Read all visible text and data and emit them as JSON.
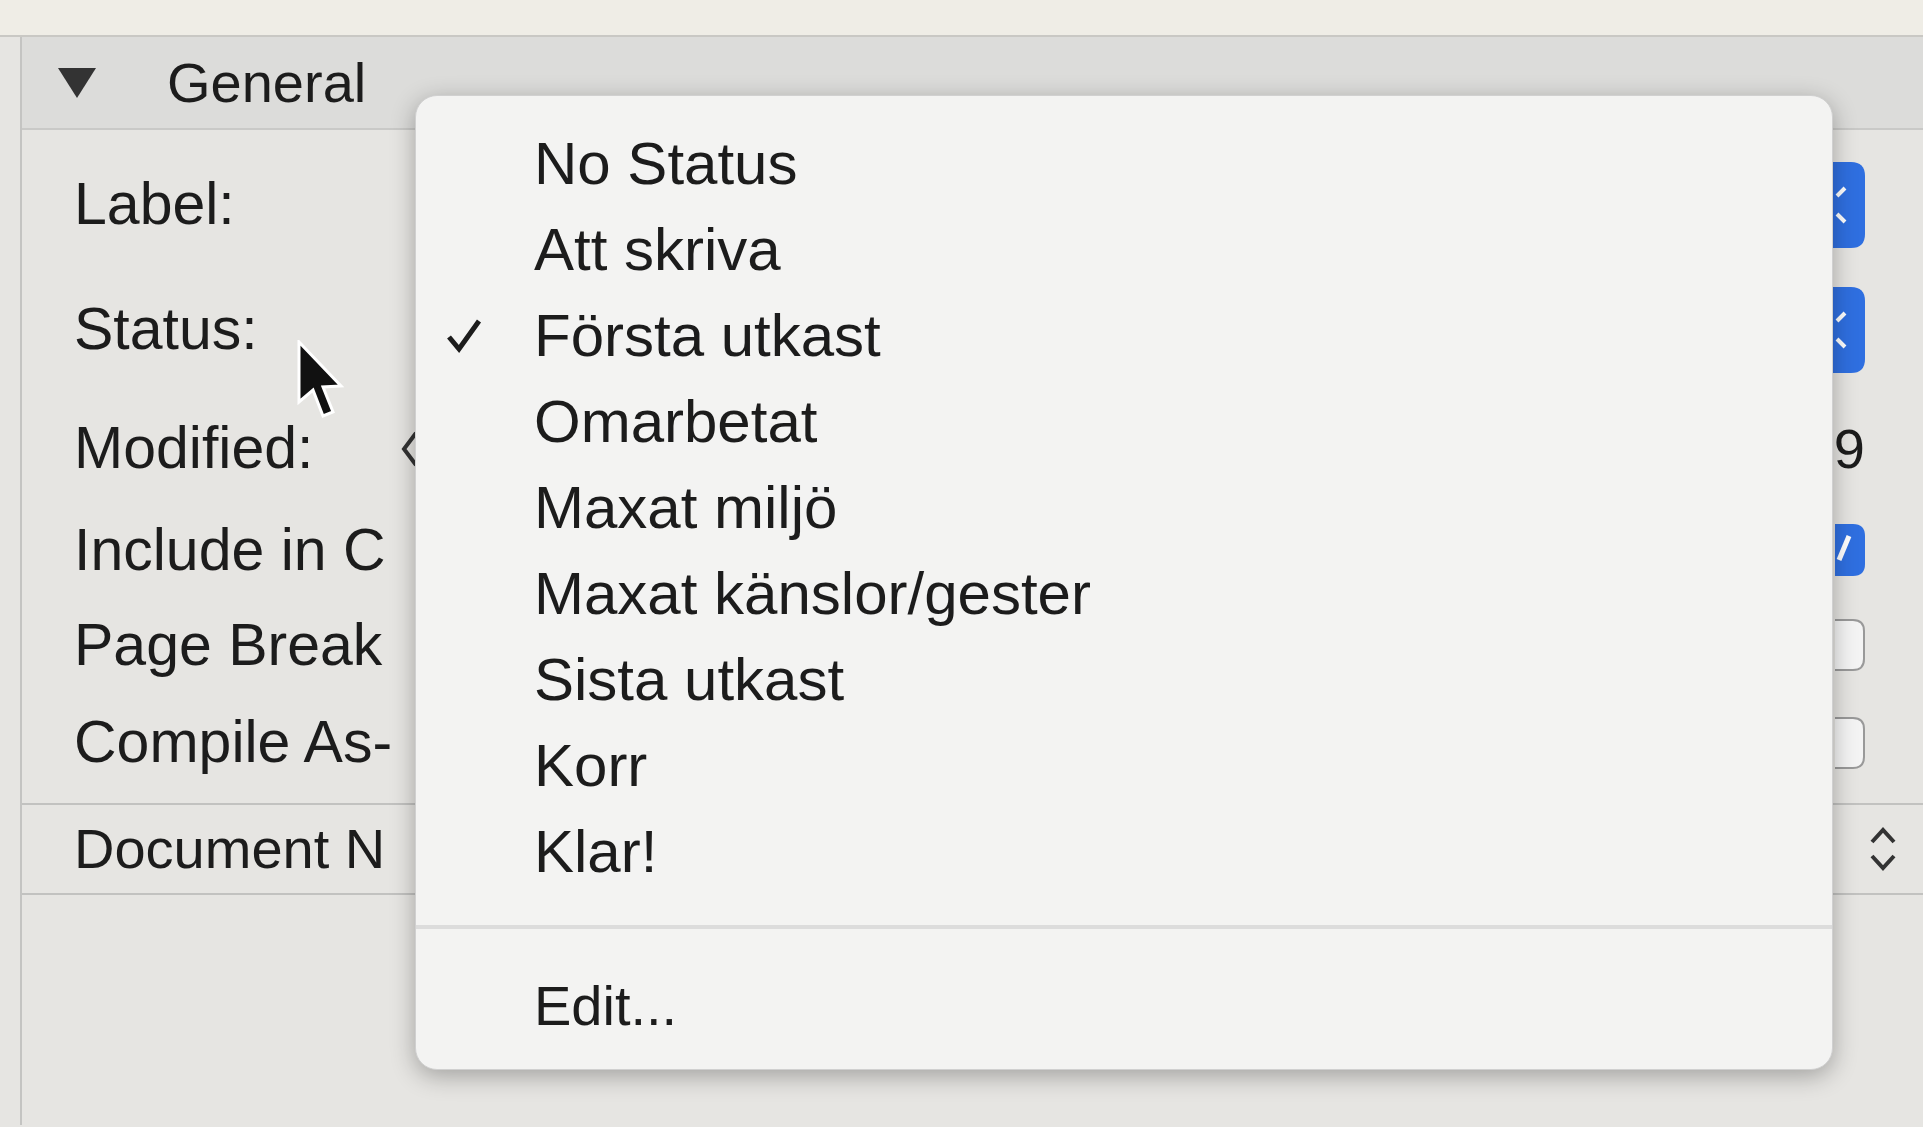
{
  "section": {
    "title": "General",
    "expanded": true
  },
  "fields": [
    {
      "label": "Label:",
      "kind": "popup"
    },
    {
      "label": "Status:",
      "kind": "popup"
    },
    {
      "label": "Modified:",
      "kind": "date",
      "value": "9"
    },
    {
      "label": "Include in C",
      "kind": "checkbox",
      "checked": true
    },
    {
      "label": "Page Break",
      "kind": "checkbox",
      "checked": false
    },
    {
      "label": "Compile As-",
      "kind": "checkbox",
      "checked": false
    }
  ],
  "document_notes": {
    "label": "Document N"
  },
  "menu": {
    "items": [
      {
        "label": "No Status",
        "selected": false
      },
      {
        "label": "Att skriva",
        "selected": false
      },
      {
        "label": "Första utkast",
        "selected": true
      },
      {
        "label": "Omarbetat",
        "selected": false
      },
      {
        "label": "Maxat miljö",
        "selected": false
      },
      {
        "label": "Maxat känslor/gester",
        "selected": false
      },
      {
        "label": "Sista utkast",
        "selected": false
      },
      {
        "label": "Korr",
        "selected": false
      },
      {
        "label": "Klar!",
        "selected": false
      }
    ],
    "edit": "Edit..."
  }
}
